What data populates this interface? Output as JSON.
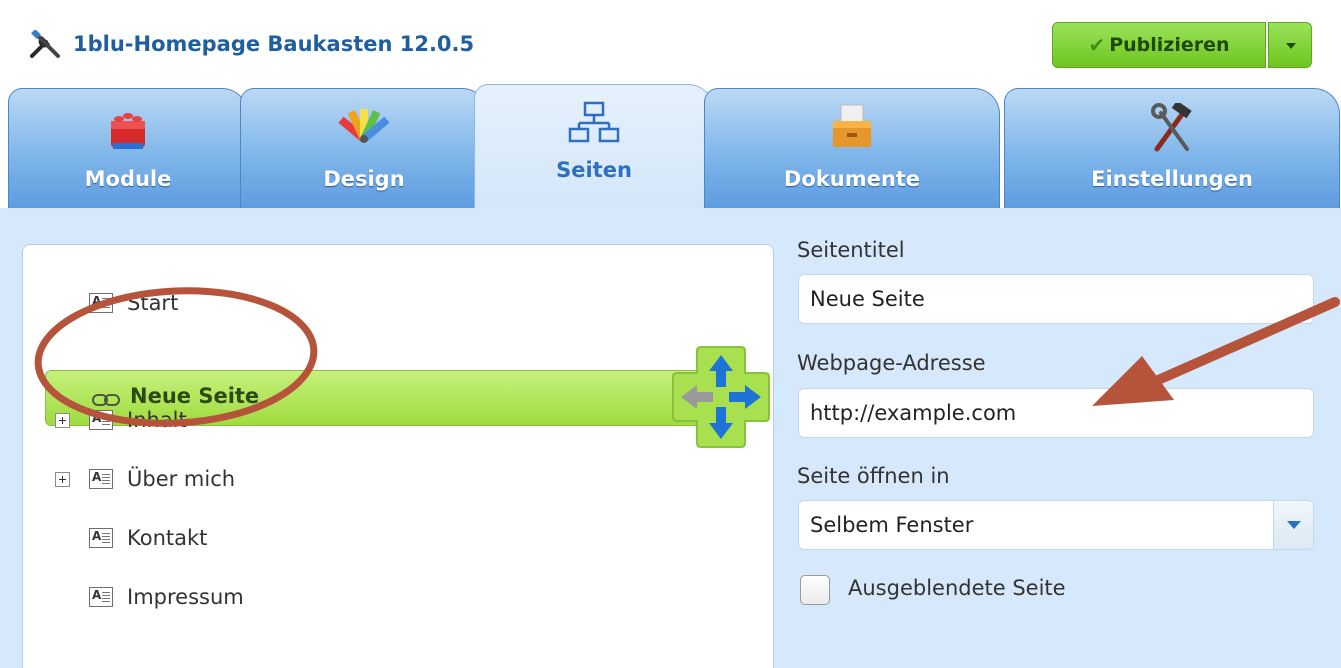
{
  "app": {
    "title": "1blu-Homepage Baukasten 12.0.5",
    "logo_icon": "tools-icon"
  },
  "publish": {
    "label": "Publizieren",
    "icon": "checkmark-icon",
    "dropdown_icon": "caret-down-icon",
    "color": "#7fd232"
  },
  "tabs": [
    {
      "label": "Module",
      "icon": "lego-brick-icon",
      "active": false
    },
    {
      "label": "Design",
      "icon": "color-palette-icon",
      "active": false
    },
    {
      "label": "Seiten",
      "icon": "sitemap-icon",
      "active": true
    },
    {
      "label": "Dokumente",
      "icon": "document-box-icon",
      "active": false
    },
    {
      "label": "Einstellungen",
      "icon": "hammer-wrench-icon",
      "active": false
    }
  ],
  "page_tree": {
    "items": [
      {
        "label": "Start",
        "icon": "page-icon",
        "expandable": false,
        "selected": false
      },
      {
        "label": "Neue Seite",
        "icon": "link-icon",
        "expandable": false,
        "selected": true
      },
      {
        "label": "Inhalt",
        "icon": "page-icon",
        "expandable": true,
        "selected": false
      },
      {
        "label": "Über mich",
        "icon": "page-icon",
        "expandable": true,
        "selected": false
      },
      {
        "label": "Kontakt",
        "icon": "page-icon",
        "expandable": false,
        "selected": false
      },
      {
        "label": "Impressum",
        "icon": "page-icon",
        "expandable": false,
        "selected": false
      }
    ],
    "selected_color": "#a8e04f"
  },
  "form": {
    "title_label": "Seitentitel",
    "title_value": "Neue Seite",
    "address_label": "Webpage-Adresse",
    "address_value": "http://example.com",
    "open_in_label": "Seite öffnen in",
    "open_in_value": "Selbem Fenster",
    "hidden_label": "Ausgeblendete Seite",
    "hidden_checked": false
  },
  "annotations": {
    "color": "#b5543a"
  },
  "colors": {
    "tab_blue": "#6aa6e6",
    "active_tab_text": "#2e6fc2",
    "title_blue": "#1f5f9e",
    "content_background": "#d6e8fb"
  }
}
